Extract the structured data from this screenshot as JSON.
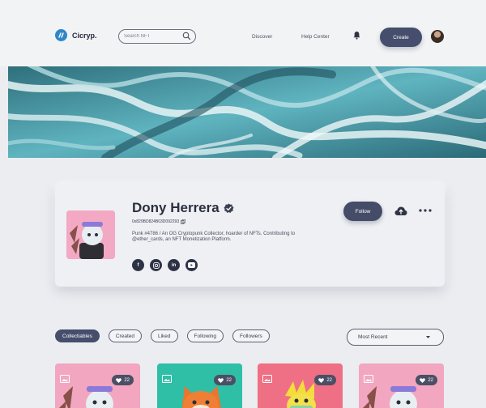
{
  "brand": {
    "name": "Cicryp."
  },
  "search": {
    "placeholder": "Search NFT"
  },
  "nav": {
    "discover": "Discover",
    "help_center": "Help Center",
    "create_label": "Create"
  },
  "profile": {
    "name": "Dony Herrera",
    "address": "0x829BD824B03D092293",
    "bio": "Punk #4786 / An OG Cryptopunk Collector, hoarder of NFTs. Contributing to @ether_cards, an NFT Monetization Platform.",
    "follow_label": "Follow",
    "socials": [
      {
        "icon": "facebook-icon",
        "glyph": "f"
      },
      {
        "icon": "instagram-icon",
        "glyph": "◙"
      },
      {
        "icon": "linkedin-icon",
        "glyph": "in"
      },
      {
        "icon": "youtube-icon",
        "glyph": "▶"
      }
    ]
  },
  "tabs": [
    {
      "label": "Collectiables",
      "active": true
    },
    {
      "label": "Created",
      "active": false
    },
    {
      "label": "Liked",
      "active": false
    },
    {
      "label": "Following",
      "active": false
    },
    {
      "label": "Followers",
      "active": false
    }
  ],
  "sort": {
    "selected": "Most Recent"
  },
  "cards": [
    {
      "likes": "22",
      "bg": "#f2a6c0"
    },
    {
      "likes": "22",
      "bg": "#2fbfa6"
    },
    {
      "likes": "22",
      "bg": "#ef6f84"
    },
    {
      "likes": "22",
      "bg": "#f2a6c0"
    }
  ],
  "colors": {
    "accent": "#454e6c",
    "background": "#ebedf0",
    "logo": "#2f86c9"
  }
}
